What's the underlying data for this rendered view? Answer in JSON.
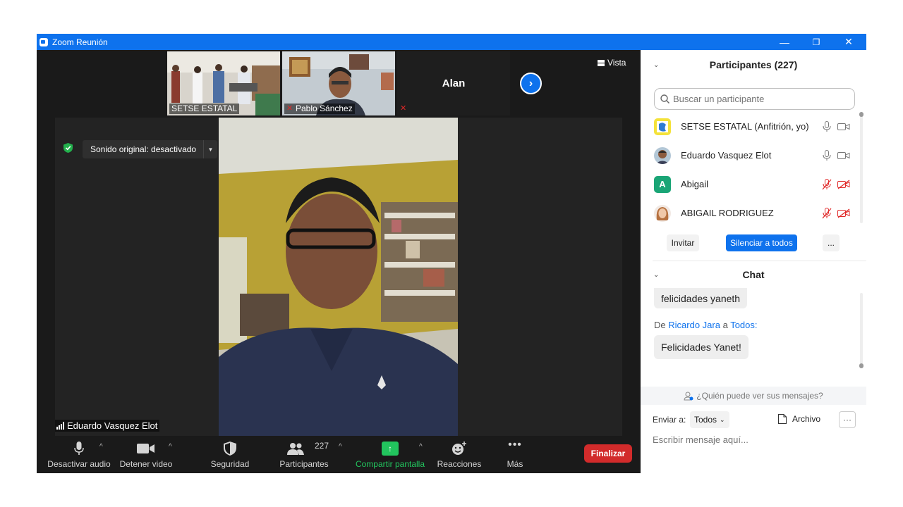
{
  "window": {
    "title": "Zoom Reunión",
    "minimize_icon": "—",
    "restore_icon": "❐",
    "close_icon": "✕"
  },
  "top_bar": {
    "thumbnails": [
      {
        "name": "SETSE ESTATAL"
      },
      {
        "name": "Pablo Sánchez"
      },
      {
        "name": "Alan"
      }
    ],
    "view_label": "Vista"
  },
  "meeting": {
    "original_sound_label": "Sonido original: desactivado",
    "active_speaker_name": "Eduardo Vasquez Elot"
  },
  "toolbar": {
    "audio_label": "Desactivar audio",
    "video_label": "Detener video",
    "security_label": "Seguridad",
    "participants_label": "Participantes",
    "participants_count": "227",
    "share_label": "Compartir pantalla",
    "reactions_label": "Reacciones",
    "more_label": "Más",
    "end_label": "Finalizar"
  },
  "participants_panel": {
    "title": "Participantes (227)",
    "search_placeholder": "Buscar un participante",
    "list": [
      {
        "name": "SETSE ESTATAL (Anfitrión, yo)",
        "muted": false,
        "video_off": false
      },
      {
        "name": "Eduardo Vasquez Elot",
        "muted": false,
        "video_off": false
      },
      {
        "name": "Abigail",
        "initial": "A",
        "muted": true,
        "video_off": true
      },
      {
        "name": "ABIGAIL RODRIGUEZ",
        "muted": true,
        "video_off": true
      }
    ],
    "invite_label": "Invitar",
    "mute_all_label": "Silenciar a todos",
    "more_label": "..."
  },
  "chat_panel": {
    "title": "Chat",
    "messages": [
      {
        "text": "felicidades yaneth"
      },
      {
        "prefix": "De",
        "from": "Ricardo Jara",
        "connector": "a",
        "to": "Todos:",
        "text": "Felicidades Yanet!"
      }
    ],
    "who_can_see": "¿Quién puede ver sus mensajes?",
    "send_to_label": "Enviar a:",
    "send_to_value": "Todos",
    "file_label": "Archivo",
    "more_label": "···",
    "input_placeholder": "Escribir mensaje aquí..."
  },
  "colors": {
    "zoom_blue": "#0e72ed",
    "end_red": "#d22b2b",
    "share_green": "#22c55e",
    "muted_red": "#e02828"
  }
}
